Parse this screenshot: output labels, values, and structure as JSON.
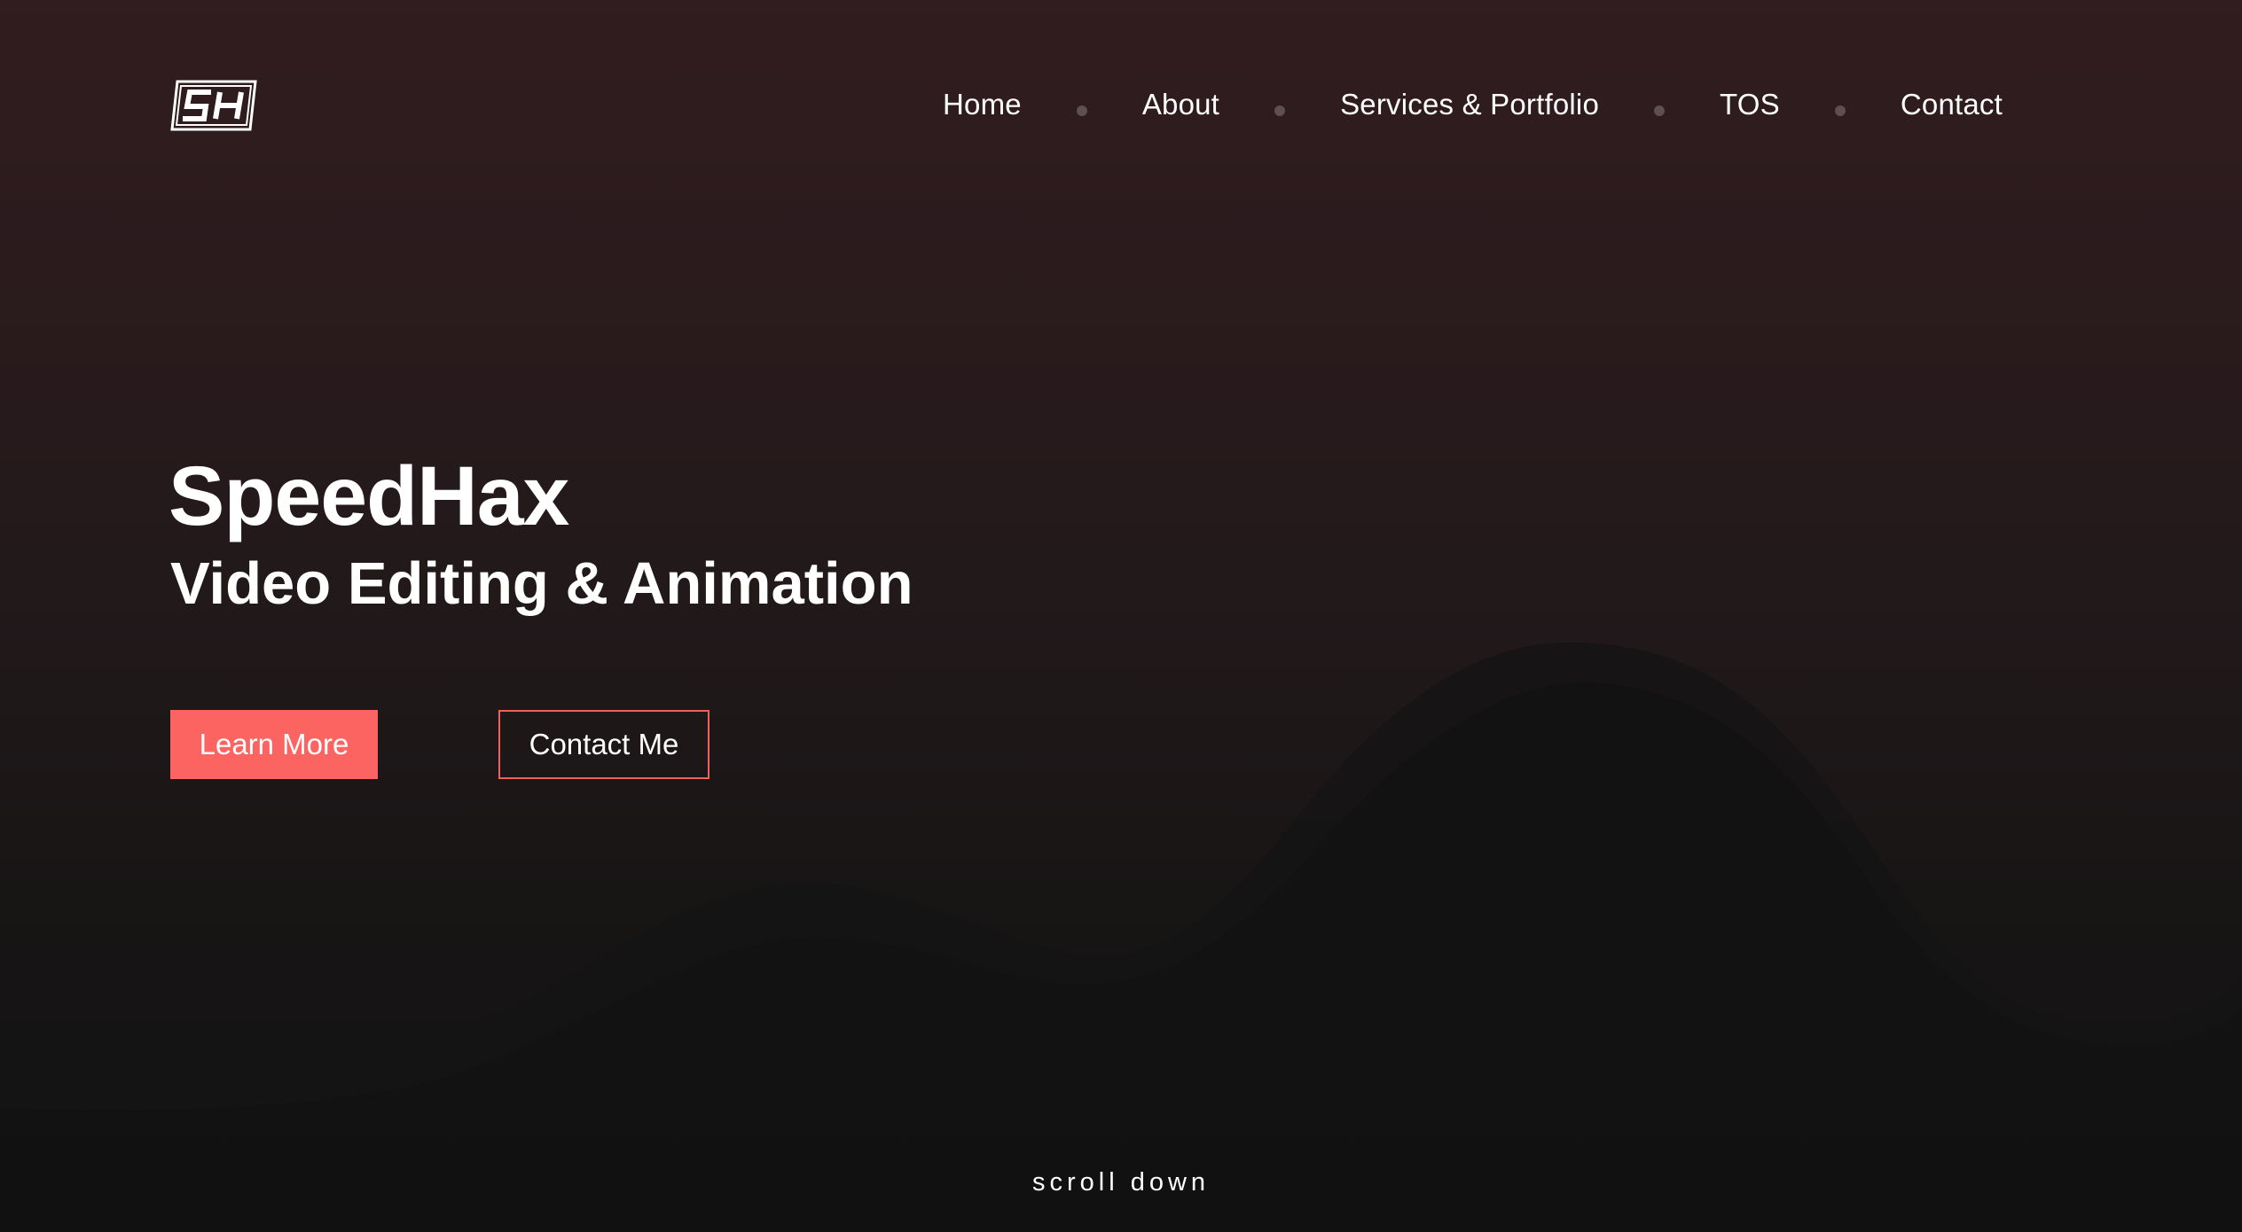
{
  "header": {
    "logo_text": "SH",
    "nav": [
      {
        "label": "Home"
      },
      {
        "label": "About"
      },
      {
        "label": "Services & Portfolio"
      },
      {
        "label": "TOS"
      },
      {
        "label": "Contact"
      }
    ]
  },
  "hero": {
    "title": "SpeedHax",
    "subtitle": "Video Editing & Animation",
    "primary_button": "Learn More",
    "secondary_button": "Contact Me"
  },
  "scroll_hint": "scroll down",
  "colors": {
    "accent": "#fb6461",
    "background_top": "#311c1f",
    "background_bottom": "#131313",
    "nav_dot": "#5c5052"
  },
  "icons": {
    "logo": "sh-logo-icon",
    "separator": "dot-separator-icon"
  }
}
